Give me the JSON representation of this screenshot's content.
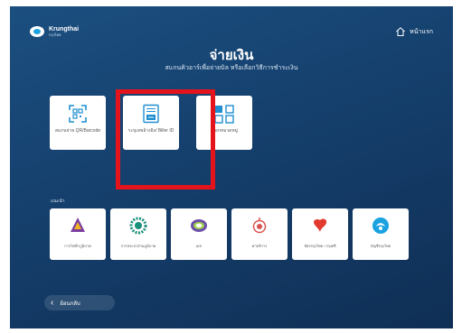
{
  "header": {
    "brand": "Krungthai",
    "brand_sub": "กรุงไทย",
    "home_label": "หน้าแรก"
  },
  "page": {
    "title": "จ่ายเงิน",
    "subtitle": "สแกนคิวอาร์เพื่อจ่ายบิล หรือเลือกวิธีการชำระเงิน"
  },
  "main_options": [
    {
      "label": "สแกนจ่าย QR/Barcode",
      "icon": "qr-scan-icon"
    },
    {
      "label": "ระบุเลขอ้างอิง/ Biller ID",
      "icon": "biller-id-icon"
    },
    {
      "label": "เลือกหมวดหมู่",
      "icon": "category-grid-icon"
    }
  ],
  "section_label": "แนะนำ",
  "recommended": [
    {
      "label": "การไฟฟ้าภูมิภาค",
      "icon": "electricity-icon"
    },
    {
      "label": "การประปาส่วนภูมิภาค",
      "icon": "water-icon"
    },
    {
      "label": "AIS",
      "icon": "ais-icon"
    },
    {
      "label": "ค่าบริการ",
      "icon": "service-icon"
    },
    {
      "label": "บัตรกรุงไทย / กรุงศรี",
      "icon": "card-icon"
    },
    {
      "label": "บัญชีกรุงไทย",
      "icon": "krungthai-icon"
    }
  ],
  "footer": {
    "back_label": "ย้อนกลับ"
  },
  "colors": {
    "background": "#153f6c",
    "highlight": "#e5141c",
    "accent": "#1aa3e0"
  }
}
